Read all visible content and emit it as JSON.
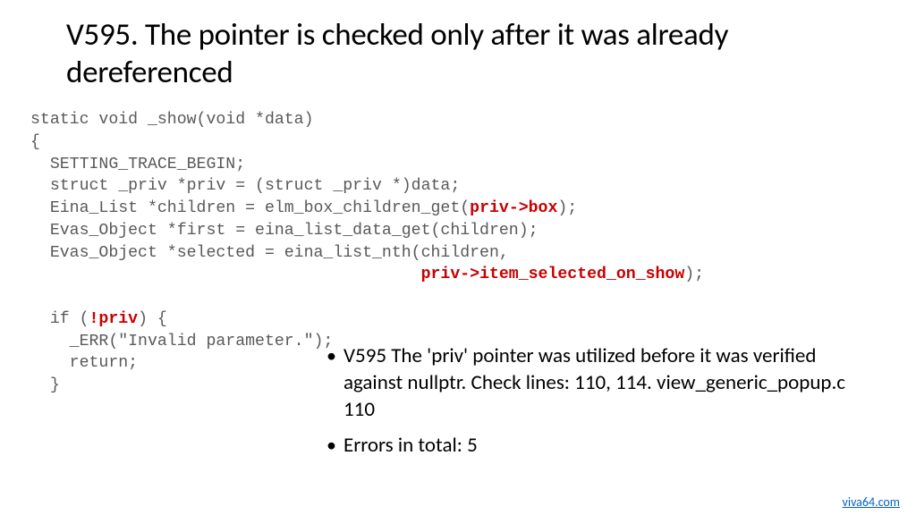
{
  "title": "V595. The pointer is checked only after it was already dereferenced",
  "code": {
    "l1": "static void _show(void *data)",
    "l2": "{",
    "l3a": "  SETTING_TRACE_BEGIN;",
    "l4a": "  struct _priv *priv = (struct _priv *)data;",
    "l5a": "  Eina_List *children = elm_box_children_get(",
    "l5b": "priv->box",
    "l5c": ");",
    "l6a": "  Evas_Object *first = eina_list_data_get(children);",
    "l7a": "  Evas_Object *selected = eina_list_nth(children,",
    "l8pad": "                                        ",
    "l8b": "priv->item_selected_on_show",
    "l8c": ");",
    "blank": "",
    "l10a": "  if (",
    "l10b": "!priv",
    "l10c": ") {",
    "l11a": "    _ERR(\"Invalid parameter.\");",
    "l12a": "    return;",
    "l13a": "  }"
  },
  "bullets": [
    "V595 The 'priv' pointer was utilized before it was verified against nullptr. Check lines: 110, 114. view_generic_popup.c 110",
    "Errors in total: 5"
  ],
  "footer": "viva64.com"
}
